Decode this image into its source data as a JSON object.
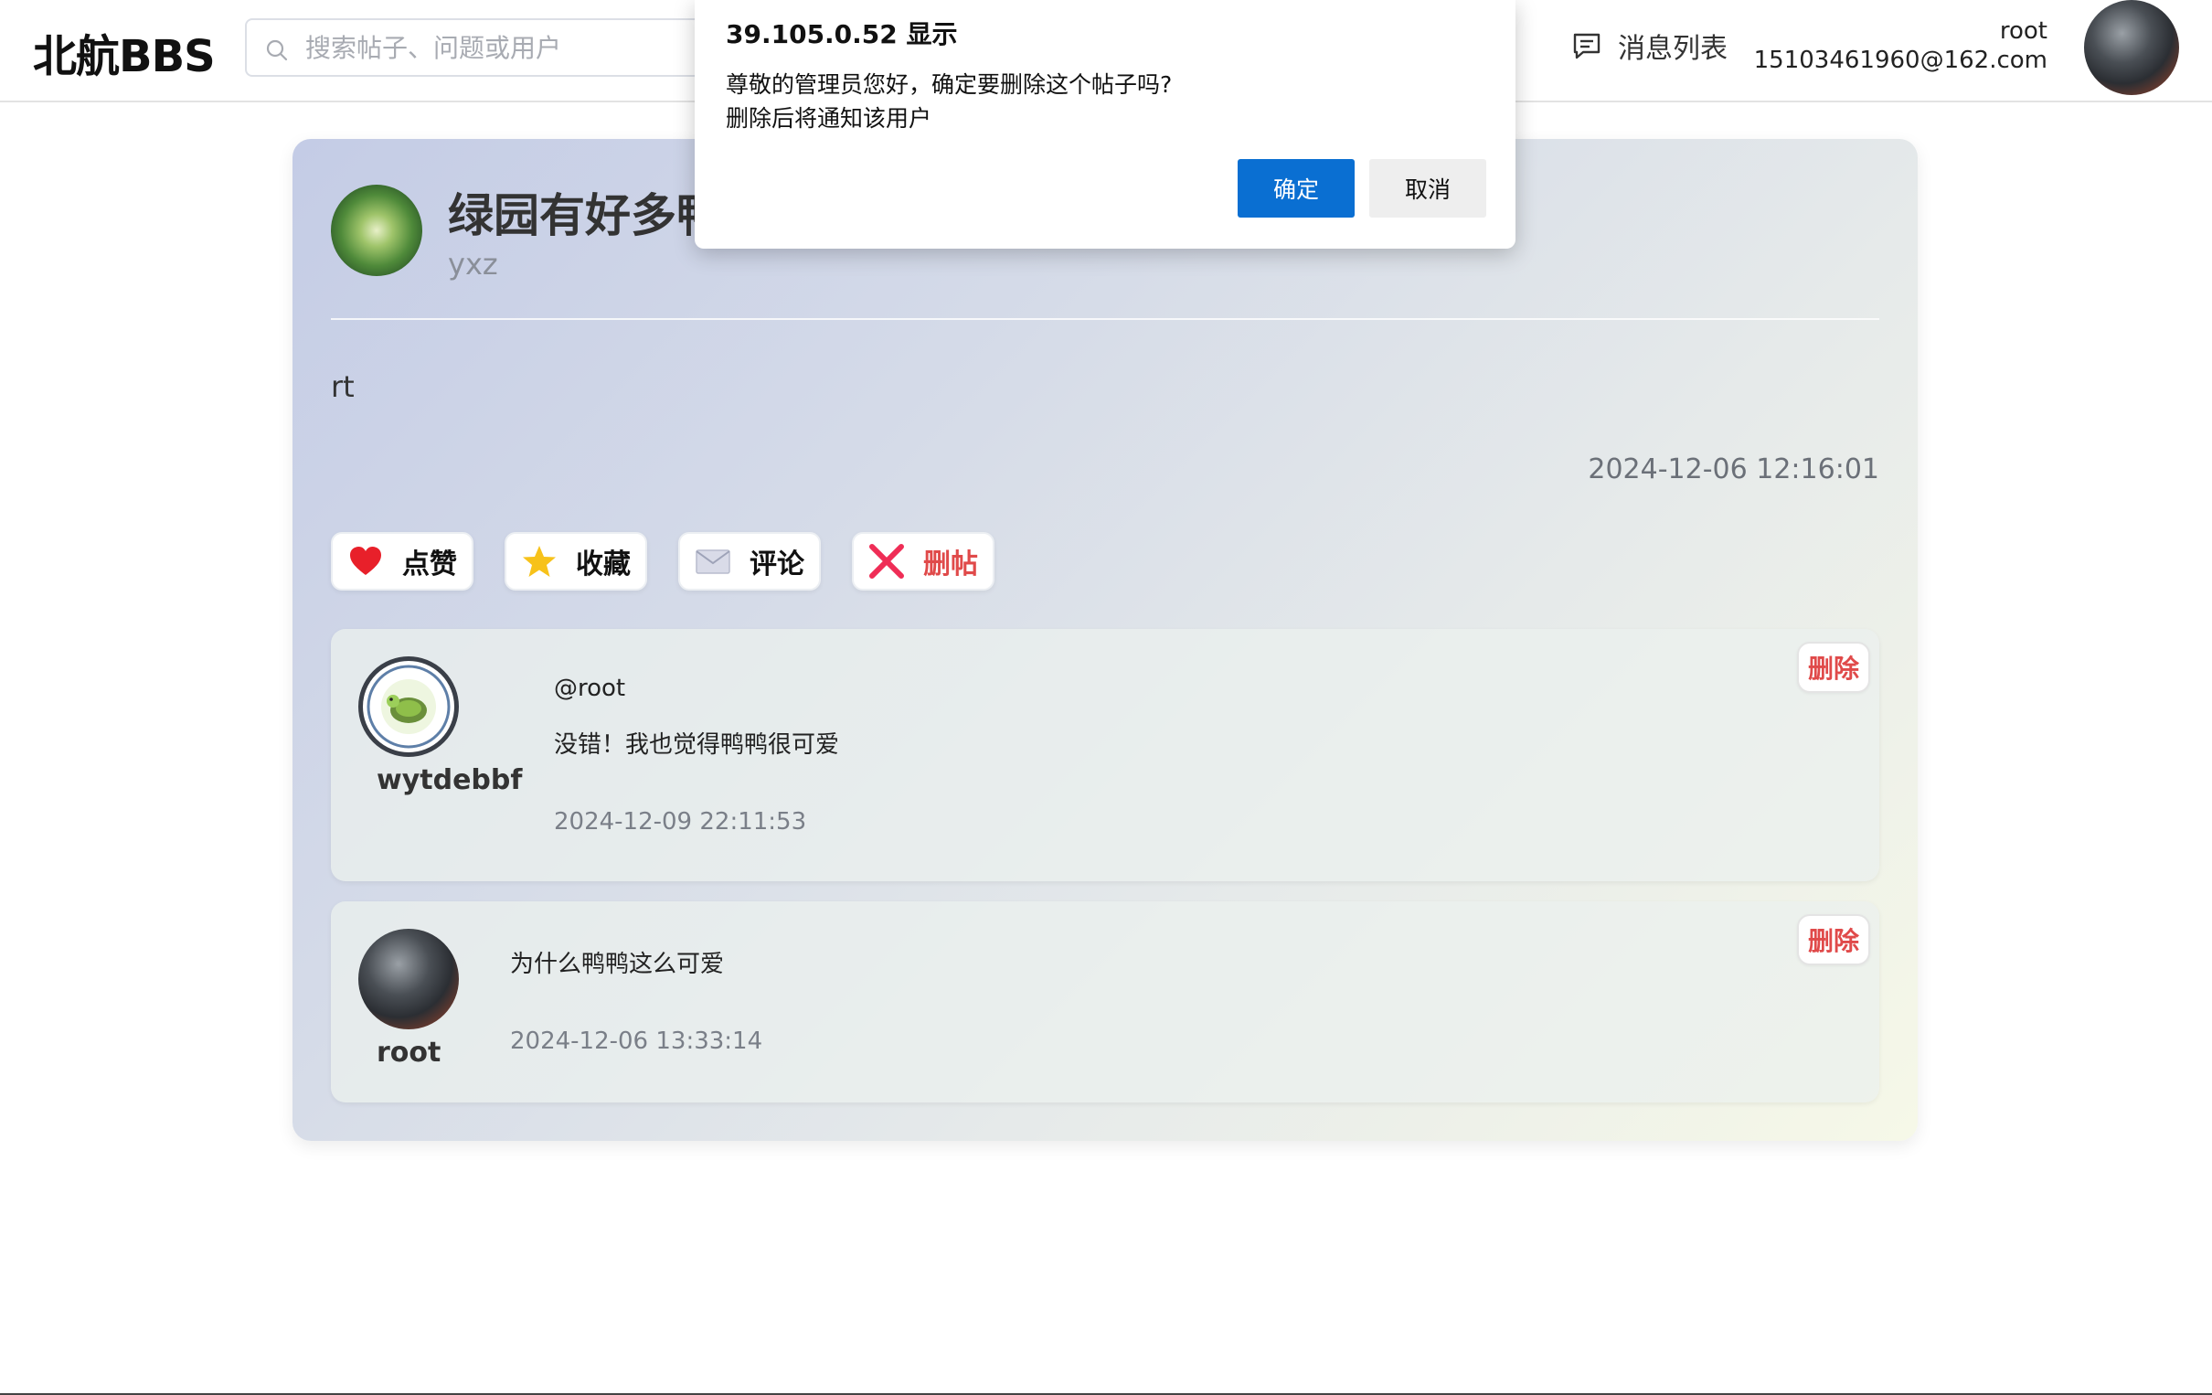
{
  "header": {
    "logo": "北航BBS",
    "search_placeholder": "搜索帖子、问题或用户",
    "messages_label": "消息列表",
    "user_name": "root",
    "user_email": "15103461960@162.com"
  },
  "dialog": {
    "title": "39.105.0.52 显示",
    "line1": "尊敬的管理员您好，确定要删除这个帖子吗?",
    "line2": "删除后将通知该用户",
    "ok": "确定",
    "cancel": "取消"
  },
  "post": {
    "title": "绿园有好多鸭",
    "author": "yxz",
    "body": "rt",
    "time": "2024-12-06 12:16:01",
    "actions": {
      "like": "点赞",
      "favorite": "收藏",
      "comment": "评论",
      "delete": "删帖"
    }
  },
  "comments": [
    {
      "user": "wytdebbf",
      "reply_to": "@root",
      "text": "没错！我也觉得鸭鸭很可爱",
      "time": "2024-12-09 22:11:53",
      "delete_label": "删除"
    },
    {
      "user": "root",
      "text": "为什么鸭鸭这么可爱",
      "time": "2024-12-06 13:33:14",
      "delete_label": "删除"
    }
  ],
  "colors": {
    "accent": "#0a6fd2",
    "danger": "#e04a4a"
  }
}
